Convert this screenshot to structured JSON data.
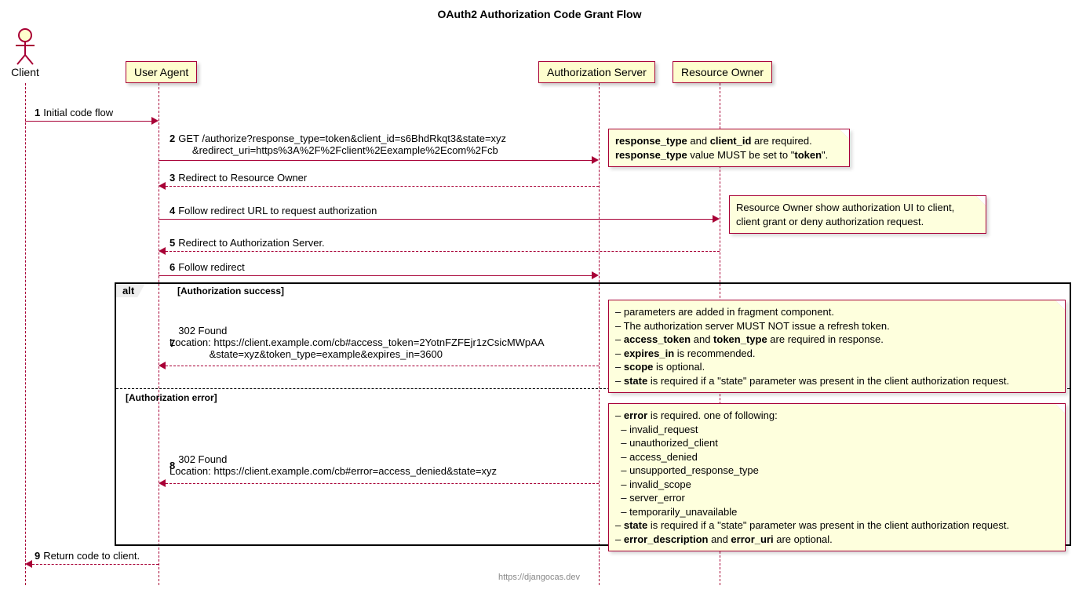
{
  "title": "OAuth2 Authorization Code Grant Flow",
  "participants": {
    "client": "Client",
    "user_agent": "User Agent",
    "auth_server": "Authorization Server",
    "resource_owner": "Resource Owner"
  },
  "messages": {
    "m1": {
      "num": "1",
      "text": "Initial code flow"
    },
    "m2": {
      "num": "2",
      "text": "GET /authorize?response_type=token&client_id=s6BhdRkqt3&state=xyz\n        &redirect_uri=https%3A%2F%2Fclient%2Eexample%2Ecom%2Fcb"
    },
    "m3": {
      "num": "3",
      "text": "Redirect to Resource Owner"
    },
    "m4": {
      "num": "4",
      "text": "Follow redirect URL to request authorization"
    },
    "m5": {
      "num": "5",
      "text": "Redirect to Authorization Server."
    },
    "m6": {
      "num": "6",
      "text": "Follow redirect"
    },
    "m7": {
      "num": "7",
      "text": "302 Found\nLocation: https://client.example.com/cb#access_token=2YotnFZFEjr1zCsicMWpAA\n              &state=xyz&token_type=example&expires_in=3600"
    },
    "m8": {
      "num": "8",
      "text": "302 Found\nLocation: https://client.example.com/cb#error=access_denied&state=xyz"
    },
    "m9": {
      "num": "9",
      "text": "Return code to client."
    }
  },
  "alt": {
    "label": "alt",
    "cond_success": "[Authorization success]",
    "cond_error": "[Authorization error]"
  },
  "notes": {
    "n2_html": "<b>response_type</b> and <b>client_id</b> are required.<br><b>response_type</b> value MUST be set to \"<b>token</b>\".",
    "n4_html": "Resource Owner show authorization UI to client,<br>client grant or deny authorization request.",
    "n7_html": "&ndash; parameters are added in fragment component.<br>&ndash; The authorization server MUST NOT issue a refresh token.<br>&ndash; <b>access_token</b> and <b>token_type</b> are required in response.<br>&ndash; <b>expires_in</b> is recommended.<br>&ndash; <b>scope</b> is optional.<br>&ndash; <b>state</b> is required if a \"state\" parameter was present in the client authorization request.",
    "n8_html": "&ndash; <b>error</b> is required. one of following:<br>&nbsp;&nbsp;&ndash; invalid_request<br>&nbsp;&nbsp;&ndash; unauthorized_client<br>&nbsp;&nbsp;&ndash; access_denied<br>&nbsp;&nbsp;&ndash; unsupported_response_type<br>&nbsp;&nbsp;&ndash; invalid_scope<br>&nbsp;&nbsp;&ndash; server_error<br>&nbsp;&nbsp;&ndash; temporarily_unavailable<br>&ndash; <b>state</b> is required if a \"state\" parameter was present in the client authorization request.<br>&ndash; <b>error_description</b> and <b>error_uri</b> are optional."
  },
  "footer": "https://djangocas.dev"
}
